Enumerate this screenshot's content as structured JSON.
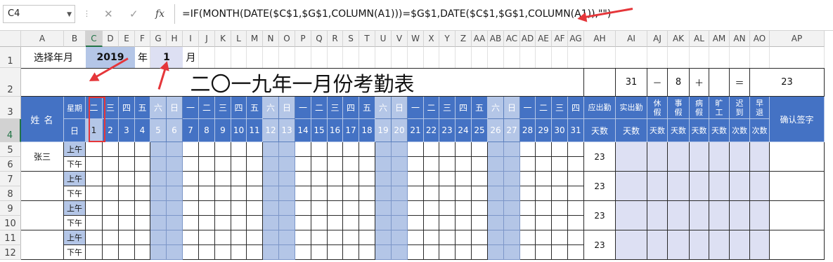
{
  "formula_bar": {
    "name_box": "C4",
    "cancel_icon": "✕",
    "enter_icon": "✓",
    "fx_label": "fx",
    "formula": "=IF(MONTH(DATE($C$1,$G$1,COLUMN(A1)))=$G$1,DATE($C$1,$G$1,COLUMN(A1)),\"\")"
  },
  "columns": [
    "A",
    "B",
    "C",
    "D",
    "E",
    "F",
    "G",
    "H",
    "I",
    "J",
    "K",
    "L",
    "M",
    "N",
    "O",
    "P",
    "Q",
    "R",
    "S",
    "T",
    "U",
    "V",
    "W",
    "X",
    "Y",
    "Z",
    "AA",
    "AB",
    "AC",
    "AD",
    "AE",
    "AF",
    "AG",
    "AH",
    "AI",
    "AJ",
    "AK",
    "AL",
    "AM",
    "AN",
    "AO",
    "AP"
  ],
  "selected_column": "C",
  "rows": [
    "1",
    "2",
    "3",
    "4",
    "5",
    "6",
    "7",
    "8",
    "9",
    "10",
    "11",
    "12"
  ],
  "selected_row": "4",
  "row1": {
    "label": "选择年月",
    "year": "2019",
    "year_unit": "年",
    "month": "1",
    "month_unit": "月"
  },
  "title": "二〇一九年一月份考勤表",
  "summary": {
    "total_days": "31",
    "minus": "－",
    "weekend_days": "8",
    "plus": "＋",
    "blank": "",
    "equals": "＝",
    "work_days": "23"
  },
  "header": {
    "name_label": "姓 名",
    "week_label": "星期",
    "day_label": "日",
    "weekdays": [
      "二",
      "三",
      "四",
      "五",
      "六",
      "日",
      "一",
      "二",
      "三",
      "四",
      "五",
      "六",
      "日",
      "一",
      "二",
      "三",
      "四",
      "五",
      "六",
      "日",
      "一",
      "二",
      "三",
      "四",
      "五",
      "六",
      "日",
      "一",
      "二",
      "三",
      "四"
    ],
    "dates": [
      "1",
      "2",
      "3",
      "4",
      "5",
      "6",
      "7",
      "8",
      "9",
      "10",
      "11",
      "12",
      "13",
      "14",
      "15",
      "16",
      "17",
      "18",
      "19",
      "20",
      "21",
      "22",
      "23",
      "24",
      "25",
      "26",
      "27",
      "28",
      "29",
      "30",
      "31"
    ],
    "weekend_indexes": [
      4,
      5,
      11,
      12,
      18,
      19,
      25,
      26
    ],
    "stats_top": [
      "应出勤",
      "实出勤",
      "休\n假",
      "事\n假",
      "病\n假",
      "旷\n工",
      "迟\n到",
      "早\n退"
    ],
    "stats_bottom": [
      "天数",
      "天数",
      "天数",
      "天数",
      "天数",
      "天数",
      "次数",
      "次数"
    ],
    "sign_label": "确认签字"
  },
  "employees": [
    {
      "name": "张三",
      "am": "上午",
      "pm": "下午",
      "days": "23"
    },
    {
      "name": "",
      "am": "上午",
      "pm": "下午",
      "days": "23"
    },
    {
      "name": "",
      "am": "上午",
      "pm": "下午",
      "days": "23"
    },
    {
      "name": "",
      "am": "上午",
      "pm": "下午",
      "days": "23"
    }
  ],
  "colors": {
    "header_blue": "#4472c4",
    "light_blue": "#b4c6e7",
    "lavender": "#dde0f3",
    "annotation_red": "#e5363a",
    "excel_green": "#217346"
  }
}
